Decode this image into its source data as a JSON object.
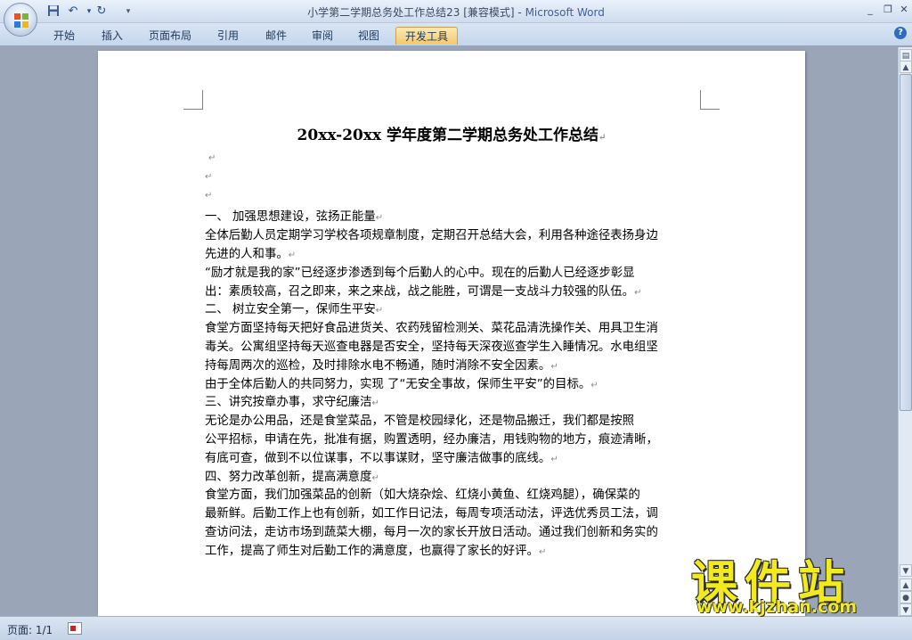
{
  "window": {
    "title_doc": "小学第二学期总务处工作总结23 [兼容模式]",
    "title_sep": " - ",
    "title_app": "Microsoft Word"
  },
  "quick_access": [
    "save-icon",
    "undo-icon",
    "redo-icon",
    "customize-icon"
  ],
  "ribbon_tabs": [
    "开始",
    "插入",
    "页面布局",
    "引用",
    "邮件",
    "审阅",
    "视图",
    "开发工具"
  ],
  "active_tab": "开发工具",
  "document": {
    "title": "20xx-20xx 学年度第二学期总务处工作总结",
    "paragraph_mark": "↵",
    "lines": [
      {
        "text": "",
        "mark": true
      },
      {
        "text": "",
        "mark": true
      },
      {
        "text": "",
        "mark": true
      },
      {
        "text": "一、            加强思想建设，弦扬正能量",
        "mark": true
      },
      {
        "text": "全体后勤人员定期学习学校各项规章制度，定期召开总结大会，利用各种途径表扬身边",
        "mark": false
      },
      {
        "text": "先进的人和事。",
        "mark": true
      },
      {
        "text": " “励才就是我的家”已经逐步渗透到每个后勤人的心中。现在的后勤人已经逐步彰显",
        "mark": false
      },
      {
        "text": "出：素质较高，召之即来，来之来战，战之能胜，可谓是一支战斗力较强的队伍。",
        "mark": true
      },
      {
        "text": "二、            树立安全第一，保师生平安",
        "mark": true
      },
      {
        "text": "食堂方面坚持每天把好食品进货关、农药残留检测关、菜花品清洗操作关、用具卫生消",
        "mark": false
      },
      {
        "text": "毒关。公寓组坚持每天巡查电器是否安全，坚持每天深夜巡查学生入睡情况。水电组坚",
        "mark": false
      },
      {
        "text": "持每周两次的巡检，及时排除水电不畅通，随时消除不安全因素。",
        "mark": true
      },
      {
        "text": "由于全体后勤人的共同努力，实现 了“无安全事故，保师生平安”的目标。",
        "mark": true
      },
      {
        "text": "三、讲究按章办事，求守纪廉洁",
        "mark": true
      },
      {
        "text": "     无论是办公用品，还是食堂菜品，不管是校园绿化，还是物品搬迁，我们都是按照",
        "mark": false
      },
      {
        "text": "公平招标，申请在先，批准有据，购置透明，经办廉洁，用钱购物的地方，痕迹清晰，",
        "mark": false
      },
      {
        "text": "有底可查，做到不以位谋事，不以事谋财，坚守廉洁做事的底线。",
        "mark": true
      },
      {
        "text": "四、努力改革创新，提高满意度",
        "mark": true
      },
      {
        "text": "    食堂方面，我们加强菜品的创新（如大烧杂烩、红烧小黄鱼、红烧鸡腿），确保菜的",
        "mark": false
      },
      {
        "text": "最新鲜。后勤工作上也有创新，如工作日记法，每周专项活动法，评选优秀员工法，调",
        "mark": false
      },
      {
        "text": "查访问法，走访市场到蔬菜大棚，每月一次的家长开放日活动。通过我们创新和务实的",
        "mark": false
      },
      {
        "text": "工作，提高了师生对后勤工作的满意度，也赢得了家长的好评。",
        "mark": true
      }
    ]
  },
  "statusbar": {
    "page": "页面: 1/1"
  },
  "watermark": {
    "text": "课件站",
    "url": "www.kjzhan.com"
  },
  "colors": {
    "ribbon_active": "#f2c96a",
    "title_app": "#3c5f9b",
    "watermark": "#f2ea1c"
  }
}
